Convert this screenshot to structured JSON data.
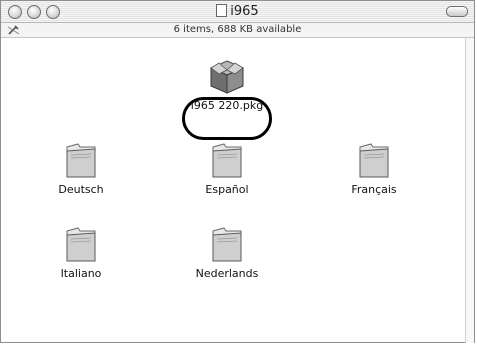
{
  "window": {
    "title": "i965",
    "status": "6 items, 688 KB available"
  },
  "package": {
    "label": "i965 220.pkg",
    "icon": "package-box-icon"
  },
  "folders": [
    {
      "label": "Deutsch",
      "icon": "folder-icon"
    },
    {
      "label": "Español",
      "icon": "folder-icon"
    },
    {
      "label": "Français",
      "icon": "folder-icon"
    },
    {
      "label": "Italiano",
      "icon": "folder-icon"
    },
    {
      "label": "Nederlands",
      "icon": "folder-icon"
    }
  ]
}
